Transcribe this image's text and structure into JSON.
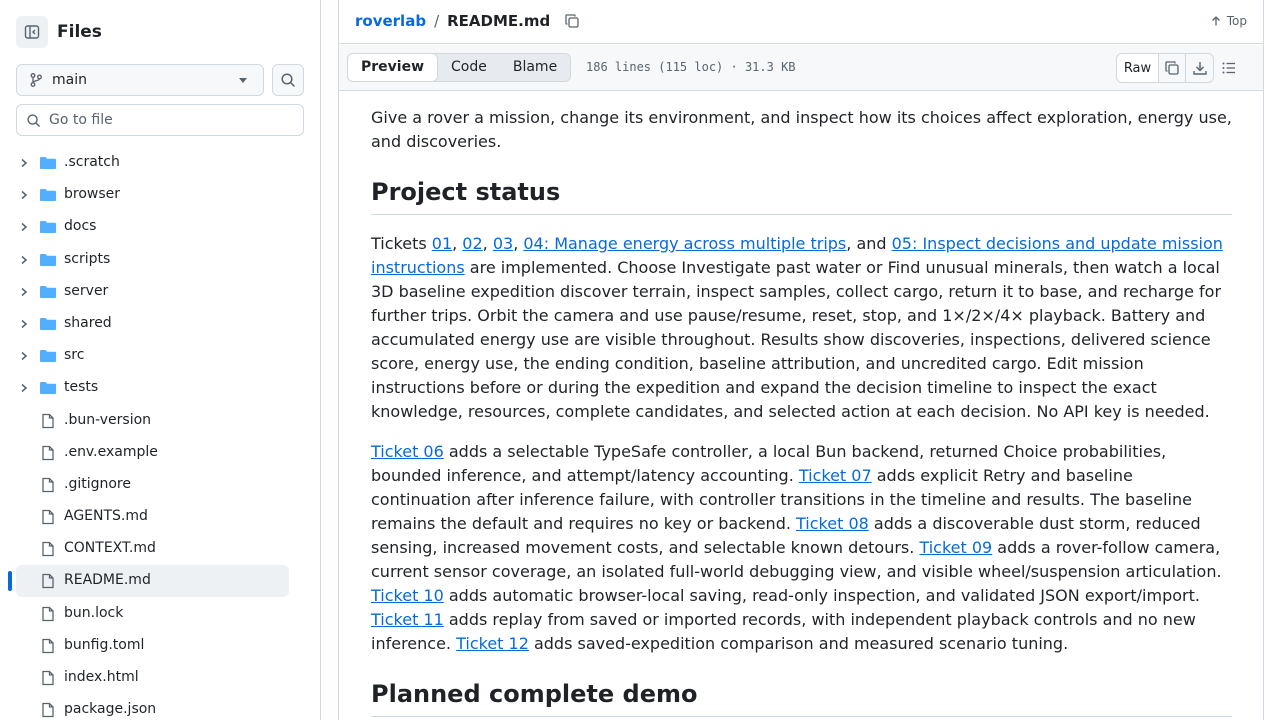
{
  "sidebar": {
    "title": "Files",
    "branch": "main",
    "goto_placeholder": "Go to file",
    "folders": [
      ".scratch",
      "browser",
      "docs",
      "scripts",
      "server",
      "shared",
      "src",
      "tests"
    ],
    "files": [
      ".bun-version",
      ".env.example",
      ".gitignore",
      "AGENTS.md",
      "CONTEXT.md",
      "README.md",
      "bun.lock",
      "bunfig.toml",
      "index.html",
      "package.json"
    ],
    "selected": "README.md"
  },
  "header": {
    "repo": "roverlab",
    "separator": "/",
    "file": "README.md",
    "top_label": "Top"
  },
  "toolbar": {
    "tabs": [
      "Preview",
      "Code",
      "Blame"
    ],
    "active_tab": "Preview",
    "meta": "186 lines (115 loc) · 31.3 KB",
    "raw_label": "Raw"
  },
  "content": {
    "intro": "Give a rover a mission, change its environment, and inspect how its choices affect exploration, energy use, and discoveries.",
    "heading_status": "Project status",
    "status": {
      "t0": "Tickets ",
      "l1": "01",
      "t1": ", ",
      "l2": "02",
      "t2": ", ",
      "l3": "03",
      "t3": ", ",
      "l4": "04: Manage energy across multiple trips",
      "t4": ", and ",
      "l5": "05: Inspect decisions and update mission instructions",
      "t5": " are implemented. Choose Investigate past water or Find unusual minerals, then watch a local 3D baseline expedition discover terrain, inspect samples, collect cargo, return it to base, and recharge for further trips. Orbit the camera and use pause/resume, reset, stop, and 1×/2×/4× playback. Battery and accumulated energy use are visible throughout. Results show discoveries, inspections, delivered science score, energy use, the ending condition, baseline attribution, and uncredited cargo. Edit mission instructions before or during the expedition and expand the decision timeline to inspect the exact knowledge, resources, complete candidates, and selected action at each decision. No API key is needed."
    },
    "tickets": {
      "l6": "Ticket 06",
      "t6": " adds a selectable TypeSafe controller, a local Bun backend, returned Choice probabilities, bounded inference, and attempt/latency accounting. ",
      "l7": "Ticket 07",
      "t7": " adds explicit Retry and baseline continuation after inference failure, with controller transitions in the timeline and results. The baseline remains the default and requires no key or backend. ",
      "l8": "Ticket 08",
      "t8": " adds a discoverable dust storm, reduced sensing, increased movement costs, and selectable known detours. ",
      "l9": "Ticket 09",
      "t9": " adds a rover-follow camera, current sensor coverage, an isolated full-world debugging view, and visible wheel/suspension articulation. ",
      "l10": "Ticket 10",
      "t10": " adds automatic browser-local saving, read-only inspection, and validated JSON export/import. ",
      "l11": "Ticket 11",
      "t11": " adds replay from saved or imported records, with independent playback controls and no new inference. ",
      "l12": "Ticket 12",
      "t12": " adds saved-expedition comparison and measured scenario tuning."
    },
    "heading_demo": "Planned complete demo"
  },
  "colors": {
    "link": "#0969da",
    "folder": "#54aeff",
    "selected_bar": "#0969da",
    "text": "#1f2328",
    "muted": "#59636e"
  }
}
